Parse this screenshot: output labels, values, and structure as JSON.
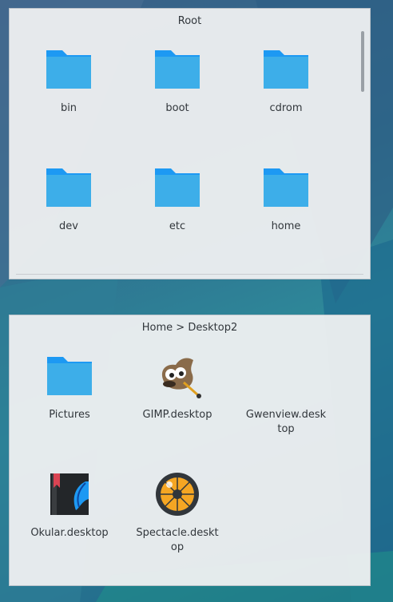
{
  "root_panel": {
    "title": "Root",
    "items": [
      {
        "label": "bin",
        "icon": "folder-icon"
      },
      {
        "label": "boot",
        "icon": "folder-icon"
      },
      {
        "label": "cdrom",
        "icon": "folder-icon"
      },
      {
        "label": "dev",
        "icon": "folder-icon"
      },
      {
        "label": "etc",
        "icon": "folder-icon"
      },
      {
        "label": "home",
        "icon": "folder-icon"
      }
    ]
  },
  "desktop_panel": {
    "title": "Home > Desktop2",
    "items": [
      {
        "label": "Pictures",
        "icon": "folder-icon"
      },
      {
        "label": "GIMP.desktop",
        "icon": "gimp-icon"
      },
      {
        "label": "Gwenview.desk top",
        "icon": "gwenview-icon"
      },
      {
        "label": "Okular.desktop",
        "icon": "okular-icon"
      },
      {
        "label": "Spectacle.deskt op",
        "icon": "spectacle-icon"
      }
    ]
  },
  "colors": {
    "folder_front": "#3daee9",
    "folder_back": "#1d99f3",
    "panel_bg": "#eff0f1",
    "text": "#31363b"
  }
}
